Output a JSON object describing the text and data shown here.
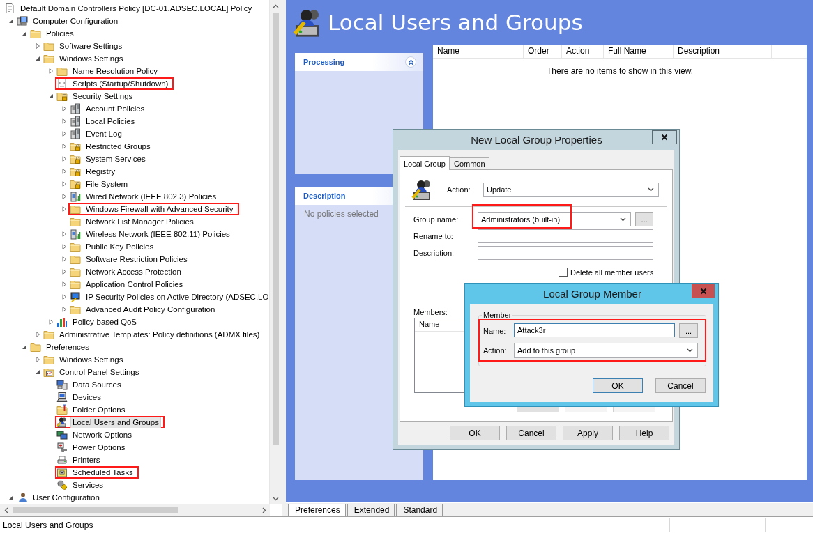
{
  "tree": [
    {
      "label": "Default Domain Controllers Policy [DC-01.ADSEC.LOCAL] Policy",
      "kind": "policy",
      "selected": false,
      "children": [
        {
          "label": "Computer Configuration",
          "kind": "computer",
          "expanded": true,
          "selected": false,
          "children": [
            {
              "label": "Policies",
              "kind": "folder",
              "expanded": true,
              "selected": false,
              "children": [
                {
                  "label": "Software Settings",
                  "kind": "folder",
                  "expanded": false,
                  "selected": false
                },
                {
                  "label": "Windows Settings",
                  "kind": "folder",
                  "expanded": true,
                  "selected": false,
                  "children": [
                    {
                      "label": "Name Resolution Policy",
                      "kind": "folder",
                      "expanded": false,
                      "selected": false
                    },
                    {
                      "label": "Scripts (Startup/Shutdown)",
                      "kind": "script",
                      "selected": false,
                      "highlighted": true
                    },
                    {
                      "label": "Security Settings",
                      "kind": "lock-folder",
                      "expanded": true,
                      "selected": false,
                      "children": [
                        {
                          "label": "Account Policies",
                          "kind": "server",
                          "expanded": false,
                          "selected": false
                        },
                        {
                          "label": "Local Policies",
                          "kind": "server",
                          "expanded": false,
                          "selected": false
                        },
                        {
                          "label": "Event Log",
                          "kind": "server",
                          "expanded": false,
                          "selected": false
                        },
                        {
                          "label": "Restricted Groups",
                          "kind": "lock-folder",
                          "expanded": false,
                          "selected": false
                        },
                        {
                          "label": "System Services",
                          "kind": "lock-folder",
                          "expanded": false,
                          "selected": false
                        },
                        {
                          "label": "Registry",
                          "kind": "lock-folder",
                          "expanded": false,
                          "selected": false
                        },
                        {
                          "label": "File System",
                          "kind": "lock-folder",
                          "expanded": false,
                          "selected": false
                        },
                        {
                          "label": "Wired Network (IEEE 802.3) Policies",
                          "kind": "network",
                          "expanded": false,
                          "selected": false
                        },
                        {
                          "label": "Windows Firewall with Advanced Security",
                          "kind": "folder",
                          "expanded": false,
                          "selected": false,
                          "highlighted": true
                        },
                        {
                          "label": "Network List Manager Policies",
                          "kind": "folder",
                          "selected": false
                        },
                        {
                          "label": "Wireless Network (IEEE 802.11) Policies",
                          "kind": "network",
                          "expanded": false,
                          "selected": false
                        },
                        {
                          "label": "Public Key Policies",
                          "kind": "folder",
                          "expanded": false,
                          "selected": false
                        },
                        {
                          "label": "Software Restriction Policies",
                          "kind": "folder",
                          "expanded": false,
                          "selected": false
                        },
                        {
                          "label": "Network Access Protection",
                          "kind": "folder",
                          "expanded": false,
                          "selected": false
                        },
                        {
                          "label": "Application Control Policies",
                          "kind": "folder",
                          "expanded": false,
                          "selected": false
                        },
                        {
                          "label": "IP Security Policies on Active Directory (ADSEC.LO",
                          "kind": "monitor-key",
                          "expanded": false,
                          "selected": false
                        },
                        {
                          "label": "Advanced Audit Policy Configuration",
                          "kind": "folder",
                          "expanded": false,
                          "selected": false
                        }
                      ]
                    },
                    {
                      "label": "Policy-based QoS",
                      "kind": "chart",
                      "expanded": false,
                      "selected": false
                    }
                  ]
                },
                {
                  "label": "Administrative Templates: Policy definitions (ADMX files)",
                  "kind": "folder",
                  "expanded": false,
                  "selected": false
                }
              ]
            },
            {
              "label": "Preferences",
              "kind": "folder",
              "expanded": true,
              "selected": false,
              "children": [
                {
                  "label": "Windows Settings",
                  "kind": "folder",
                  "expanded": false,
                  "selected": false
                },
                {
                  "label": "Control Panel Settings",
                  "kind": "control-panel",
                  "expanded": true,
                  "selected": false,
                  "children": [
                    {
                      "label": "Data Sources",
                      "kind": "computers",
                      "selected": false
                    },
                    {
                      "label": "Devices",
                      "kind": "laptop",
                      "selected": false
                    },
                    {
                      "label": "Folder Options",
                      "kind": "folder-tool",
                      "selected": false
                    },
                    {
                      "label": "Local Users and Groups",
                      "kind": "users",
                      "selected": true,
                      "highlighted": true
                    },
                    {
                      "label": "Network Options",
                      "kind": "monitors",
                      "selected": false
                    },
                    {
                      "label": "Power Options",
                      "kind": "power",
                      "selected": false
                    },
                    {
                      "label": "Printers",
                      "kind": "printer",
                      "selected": false
                    },
                    {
                      "label": "Scheduled Tasks",
                      "kind": "task",
                      "selected": false,
                      "highlighted": true
                    },
                    {
                      "label": "Services",
                      "kind": "gears",
                      "selected": false
                    }
                  ]
                }
              ]
            }
          ]
        },
        {
          "label": "User Configuration",
          "kind": "user",
          "expanded": true,
          "selected": false
        }
      ]
    }
  ],
  "panel": {
    "title": "Local Users and Groups",
    "processing": {
      "title": "Processing",
      "expanded": true
    },
    "description": {
      "title": "Description",
      "text": "No policies selected"
    },
    "list": {
      "columns": [
        "Name",
        "Order",
        "Action",
        "Full Name",
        "Description"
      ],
      "empty_text": "There are no items to show in this view."
    }
  },
  "bottom_tabs": [
    {
      "label": "Preferences",
      "selected": true
    },
    {
      "label": "Extended",
      "selected": false
    },
    {
      "label": "Standard",
      "selected": false
    }
  ],
  "status_bar": {
    "text": "Local Users and Groups"
  },
  "group_dialog": {
    "title": "New Local Group Properties",
    "tabs": [
      {
        "label": "Local Group",
        "selected": true
      },
      {
        "label": "Common",
        "selected": false
      }
    ],
    "action": {
      "label": "Action:",
      "value": "Update"
    },
    "group_name": {
      "label": "Group name:",
      "value": "Administrators (built-in)",
      "browse": "...",
      "highlighted": true
    },
    "rename_to": {
      "label": "Rename to:"
    },
    "description": {
      "label": "Description:"
    },
    "checkboxes": [
      {
        "label": "Delete all member users",
        "checked": false
      }
    ],
    "members": {
      "label": "Members:",
      "columns": [
        "Name"
      ]
    },
    "member_buttons": [
      {
        "disabled": false
      },
      {
        "disabled": true
      },
      {
        "disabled": true
      }
    ],
    "buttons": [
      "OK",
      "Cancel",
      "Apply",
      "Help"
    ]
  },
  "member_dialog": {
    "title": "Local Group Member",
    "group_label": "Member",
    "highlighted": true,
    "name": {
      "label": "Name:",
      "value": "Attack3r",
      "browse": "..."
    },
    "action": {
      "label": "Action:",
      "value": "Add to this group"
    },
    "buttons": [
      {
        "label": "OK",
        "default": true
      },
      {
        "label": "Cancel",
        "default": false
      }
    ]
  }
}
